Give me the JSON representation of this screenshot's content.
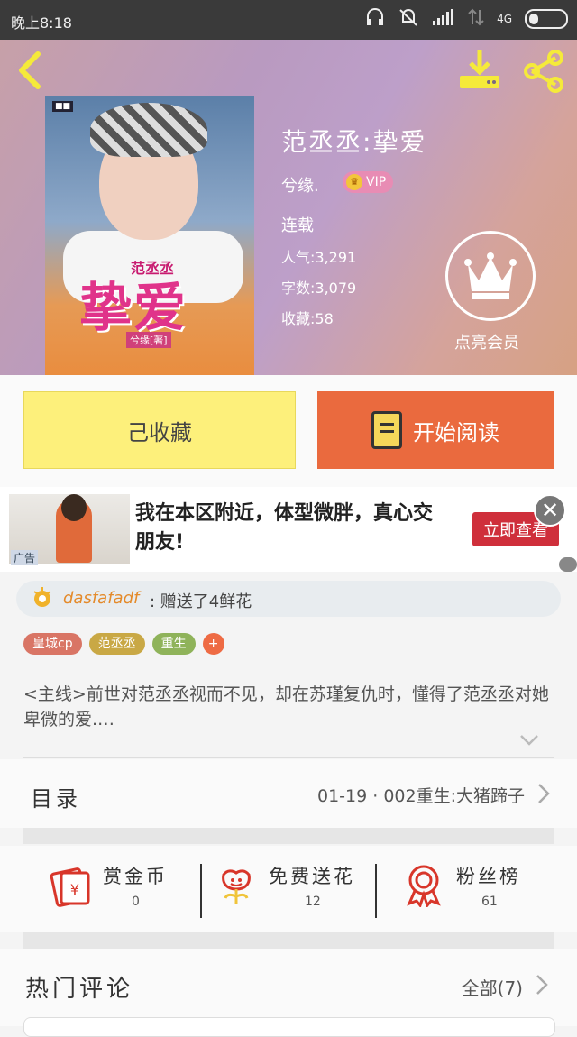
{
  "status_bar": {
    "time": "晚上8:18",
    "network": "4G"
  },
  "book": {
    "cover_series": "范丞丞",
    "cover_title": "挚爱",
    "cover_author": "兮缘[著]",
    "title": "范丞丞:挚爱",
    "author": "兮缘.",
    "vip_label": "VIP",
    "status": "连载",
    "popularity": "人气:3,291",
    "word_count": "字数:3,079",
    "favorites": "收藏:58"
  },
  "member": {
    "label": "点亮会员"
  },
  "actions": {
    "collected_label": "己收藏",
    "start_reading_label": "开始阅读"
  },
  "ad": {
    "tag": "广告",
    "text": "我在本区附近，体型微胖，真心交朋友!",
    "cta": "立即查看"
  },
  "gift": {
    "user": "dasfafadf",
    "message": ": 赠送了4鲜花"
  },
  "tags": [
    {
      "label": "皇城cp",
      "color": "#d97565"
    },
    {
      "label": "范丞丞",
      "color": "#c9a845"
    },
    {
      "label": "重生",
      "color": "#8fb35a"
    },
    {
      "label": "+",
      "color": "#ee6b44"
    }
  ],
  "intro": "<主线>前世对范丞丞视而不见，却在苏瑾复仇时，懂得了范丞丞对她卑微的爱.…",
  "toc": {
    "label": "目录",
    "latest": "01-19 · 002重生:大猪蹄子"
  },
  "stats": [
    {
      "label": "赏金币",
      "value": "0"
    },
    {
      "label": "免费送花",
      "value": "12"
    },
    {
      "label": "粉丝榜",
      "value": "61"
    }
  ],
  "comments": {
    "label": "热门评论",
    "all": "全部(7)"
  },
  "colors": {
    "accent_orange": "#ea6a3e",
    "collect_yellow": "#fdf07b",
    "icon_red": "#d8362a",
    "icon_yellow": "#f0c43a"
  }
}
